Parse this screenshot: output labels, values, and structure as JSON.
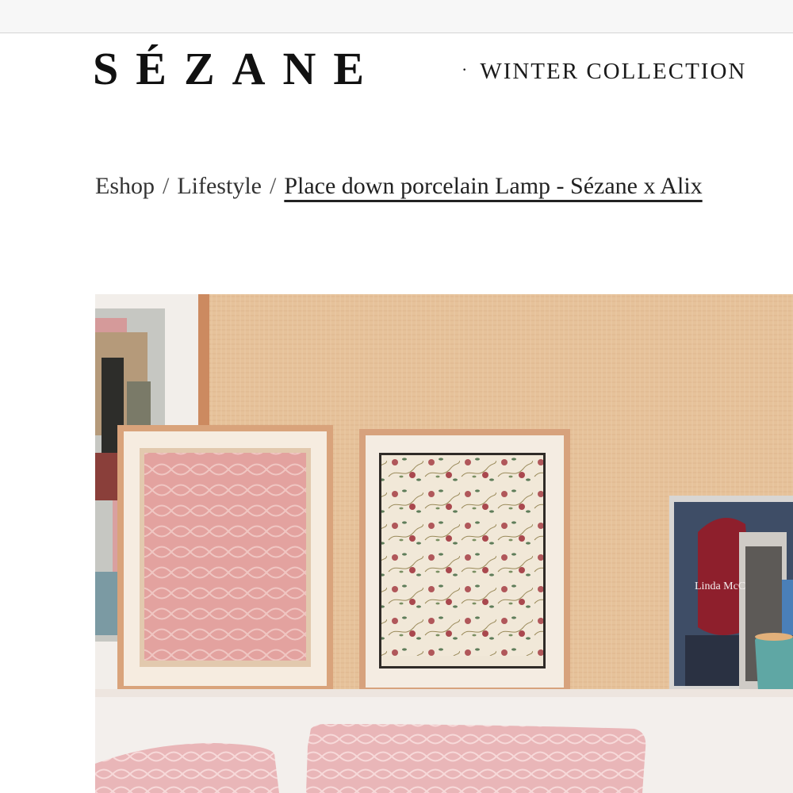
{
  "header": {
    "logo": "SÉZANE",
    "nav_dot": "·",
    "nav_label": "WINTER COLLECTION"
  },
  "breadcrumb": {
    "items": [
      "Eshop",
      "Lifestyle"
    ],
    "separator": "/",
    "current": "Place down porcelain Lamp - Sézane x Alix"
  },
  "hero_image": {
    "book_text": "Linda McC",
    "colors": {
      "raffia_wall": "#e8c49b",
      "frame_wood": "#d9a27a",
      "pink_print": "#e5a9a4",
      "floral_bg": "#f1e8d8",
      "shelf": "#f3efec",
      "cushion_pink": "#e7b3b5",
      "mug": "#5fa7a4"
    }
  }
}
